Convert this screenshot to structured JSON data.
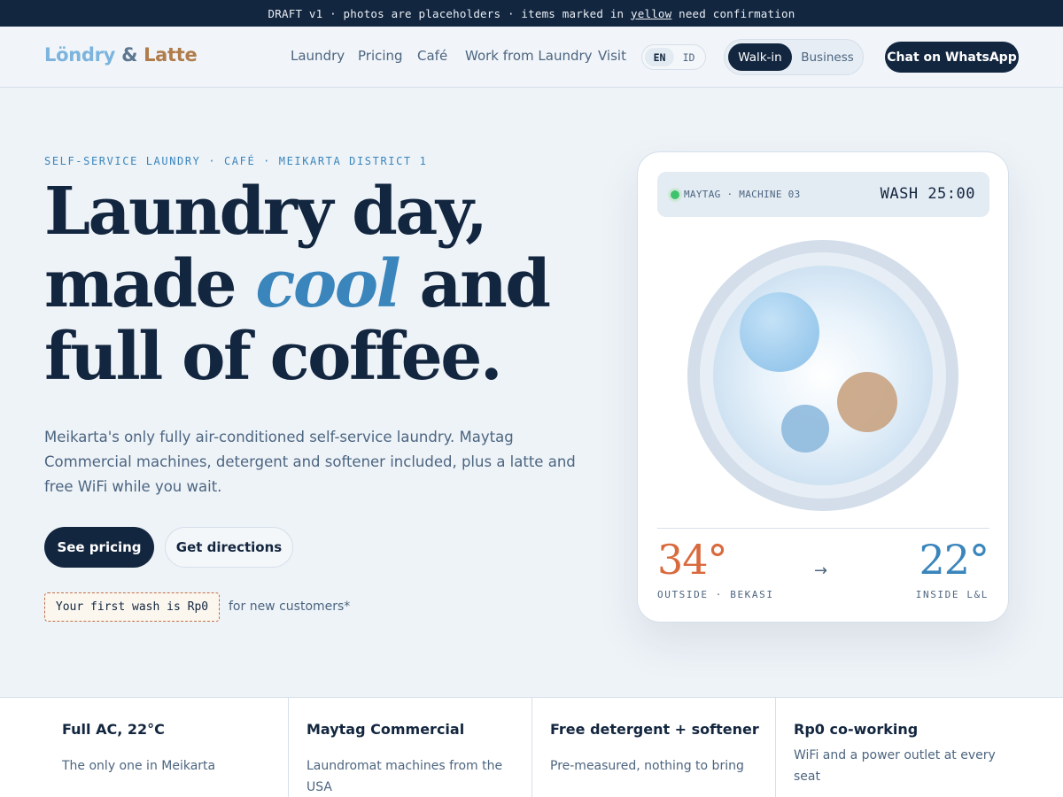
{
  "draft_bar": {
    "prefix": "DRAFT v1 · photos are placeholders · items marked in ",
    "highlight": "yellow",
    "suffix": " need confirmation"
  },
  "brand": {
    "name_a": "Löndry",
    "amp": "&",
    "name_b": "Latte"
  },
  "nav": {
    "links": [
      "Laundry",
      "Pricing",
      "Café",
      "Work from Laundry",
      "Visit"
    ],
    "lang": [
      "EN",
      "ID"
    ],
    "mode": [
      "Walk-in",
      "Business"
    ],
    "chat_button": "Chat on WhatsApp"
  },
  "hero": {
    "eyebrow": "SELF-SERVICE LAUNDRY · CAFÉ · MEIKARTA DISTRICT 1",
    "headline_line1": "Laundry day,",
    "headline_line2_a": "made ",
    "headline_line2_em": "cool",
    "headline_line2_b": " and",
    "headline_line3": "full of coffee.",
    "lede": "Meikarta's only fully air-conditioned self-service laundry. Maytag Commercial machines, detergent and softener included, plus a latte and free WiFi while you wait.",
    "primary_button": "See pricing",
    "secondary_button": "Get directions",
    "promo": "Your first wash is Rp0",
    "promo_note": "for new customers*"
  },
  "machine_card": {
    "machine": "MAYTAG · MACHINE 03",
    "status": "WASH 25:00",
    "outside_temp": "34°",
    "inside_temp": "22°",
    "arrow": "→",
    "outside_label": "OUTSIDE · BEKASI",
    "inside_label": "INSIDE L&L"
  },
  "features": [
    {
      "title": "Full AC, 22°C",
      "desc": "The only one in Meikarta"
    },
    {
      "title": "Maytag Commercial",
      "desc": "Laundromat machines from the USA"
    },
    {
      "title": "Free detergent + softener",
      "desc": "Pre-measured, nothing to bring"
    },
    {
      "title": "Rp0 co-working",
      "desc": "WiFi and a power outlet at every seat"
    }
  ],
  "colors": {
    "navy": "#13263f",
    "accent_blue": "#3a85bb",
    "accent_orange": "#d96a3e",
    "brand_brown": "#b17c4b",
    "status_green": "#3fc26c"
  }
}
